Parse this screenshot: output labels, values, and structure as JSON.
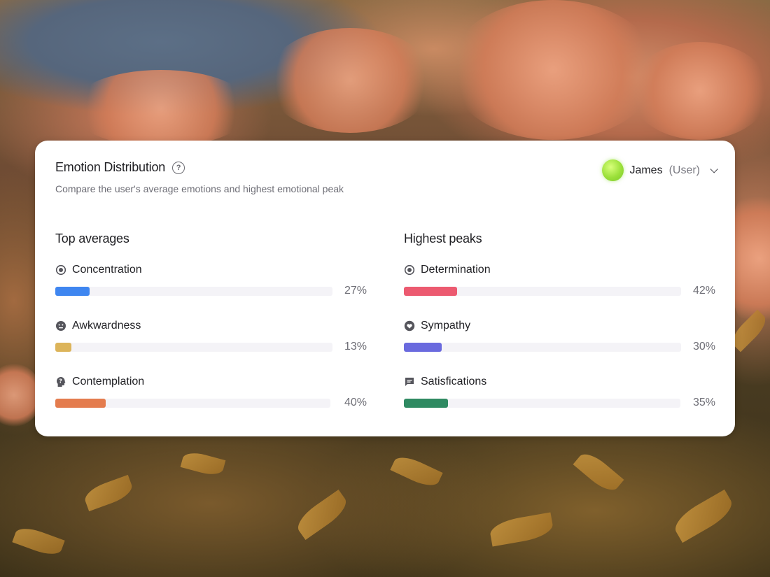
{
  "card": {
    "title": "Emotion Distribution",
    "subtitle": "Compare the user's average emotions and highest emotional peak"
  },
  "user": {
    "name": "James",
    "role": "(User)",
    "avatar_color": "#9be03a"
  },
  "top_averages": {
    "title": "Top averages",
    "items": [
      {
        "label": "Concentration",
        "icon": "target-icon",
        "value_text": "27%",
        "value": 27,
        "color": "#3f86f0"
      },
      {
        "label": "Awkwardness",
        "icon": "face-icon",
        "value_text": "13%",
        "value": 13,
        "color": "#dcb45a"
      },
      {
        "label": "Contemplation",
        "icon": "question-head-icon",
        "value_text": "40%",
        "value": 40,
        "color": "#e47c4e"
      }
    ]
  },
  "highest_peaks": {
    "title": "Highest peaks",
    "items": [
      {
        "label": "Determination",
        "icon": "target-icon",
        "value_text": "42%",
        "value": 42,
        "color": "#ec5a70"
      },
      {
        "label": "Sympathy",
        "icon": "heart-icon",
        "value_text": "30%",
        "value": 30,
        "color": "#6a6ade"
      },
      {
        "label": "Satisfications",
        "icon": "message-icon",
        "value_text": "35%",
        "value": 35,
        "color": "#2f8a62"
      }
    ]
  }
}
